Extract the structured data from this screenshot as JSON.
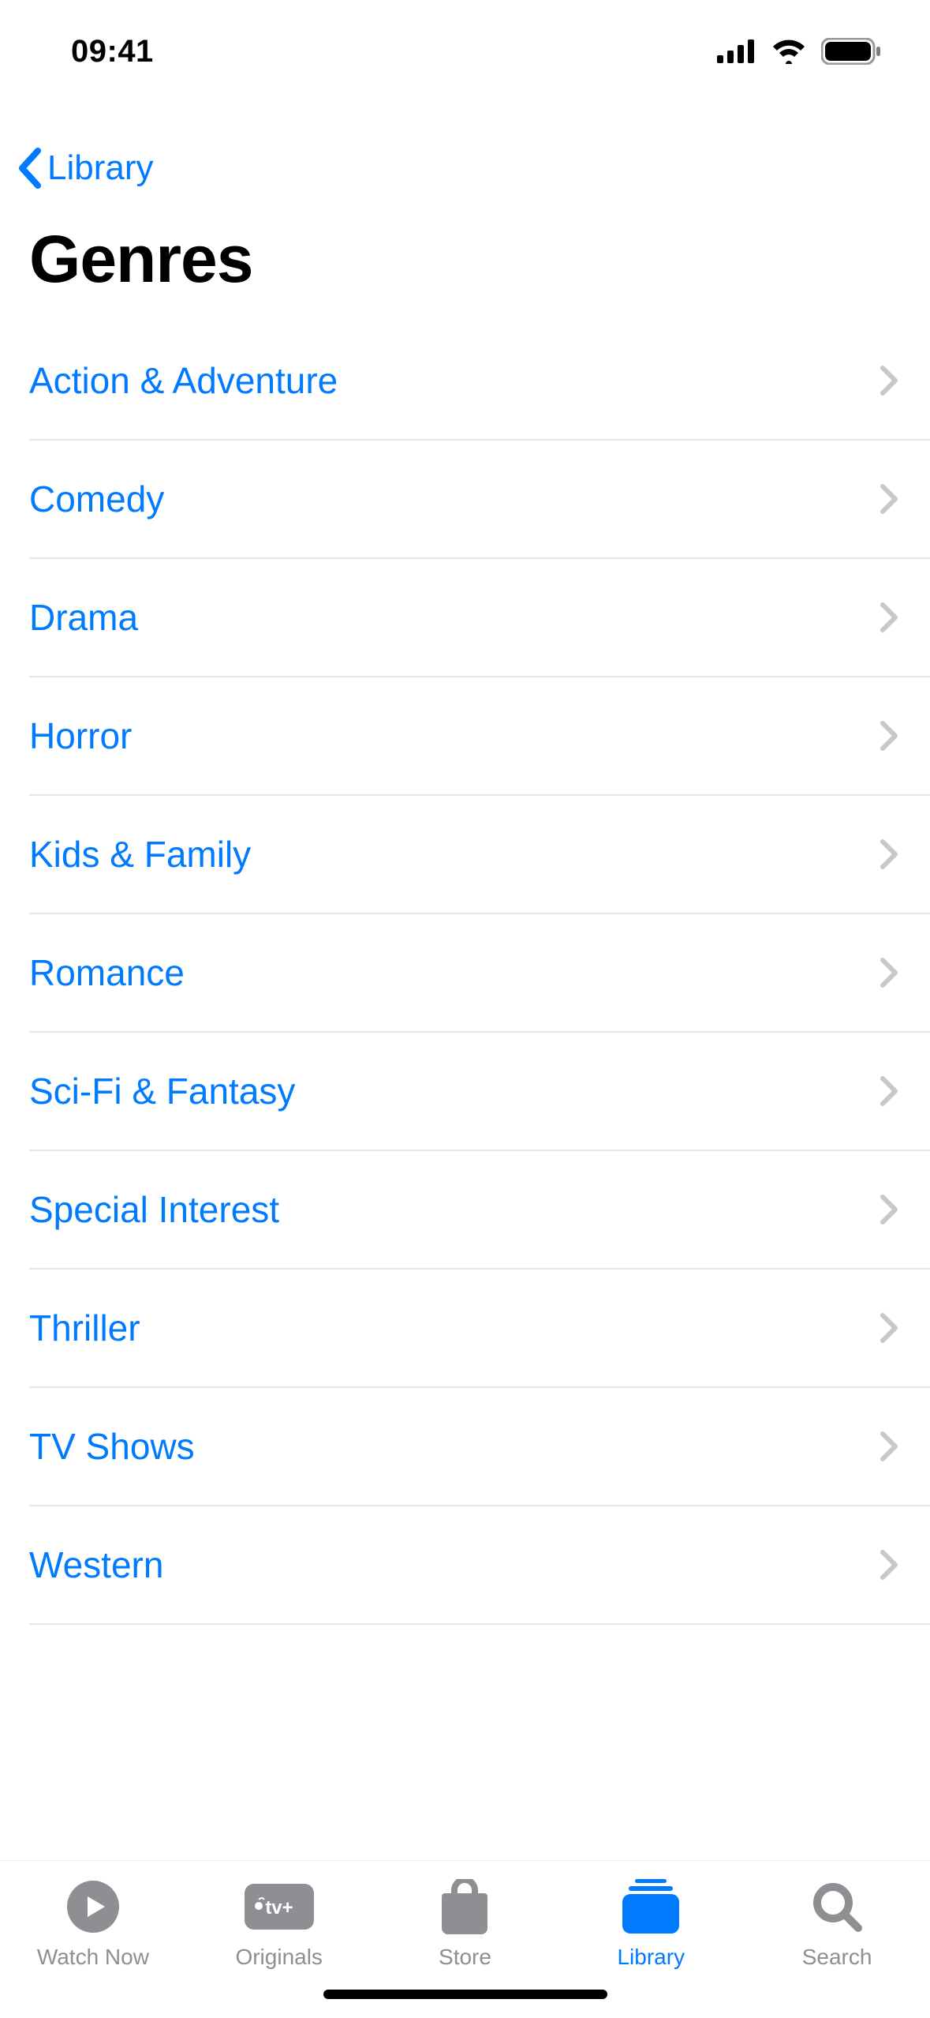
{
  "status": {
    "time": "09:41"
  },
  "nav": {
    "back_label": "Library"
  },
  "title": "Genres",
  "genres": [
    {
      "label": "Action & Adventure"
    },
    {
      "label": "Comedy"
    },
    {
      "label": "Drama"
    },
    {
      "label": "Horror"
    },
    {
      "label": "Kids & Family"
    },
    {
      "label": "Romance"
    },
    {
      "label": "Sci-Fi & Fantasy"
    },
    {
      "label": "Special Interest"
    },
    {
      "label": "Thriller"
    },
    {
      "label": "TV Shows"
    },
    {
      "label": "Western"
    }
  ],
  "tabs": [
    {
      "label": "Watch Now",
      "icon": "play-circle-icon",
      "active": false
    },
    {
      "label": "Originals",
      "icon": "appletv-icon",
      "active": false
    },
    {
      "label": "Store",
      "icon": "bag-icon",
      "active": false
    },
    {
      "label": "Library",
      "icon": "library-icon",
      "active": true
    },
    {
      "label": "Search",
      "icon": "search-icon",
      "active": false
    }
  ],
  "colors": {
    "accent": "#007AFF",
    "inactive": "#8E8E93"
  }
}
